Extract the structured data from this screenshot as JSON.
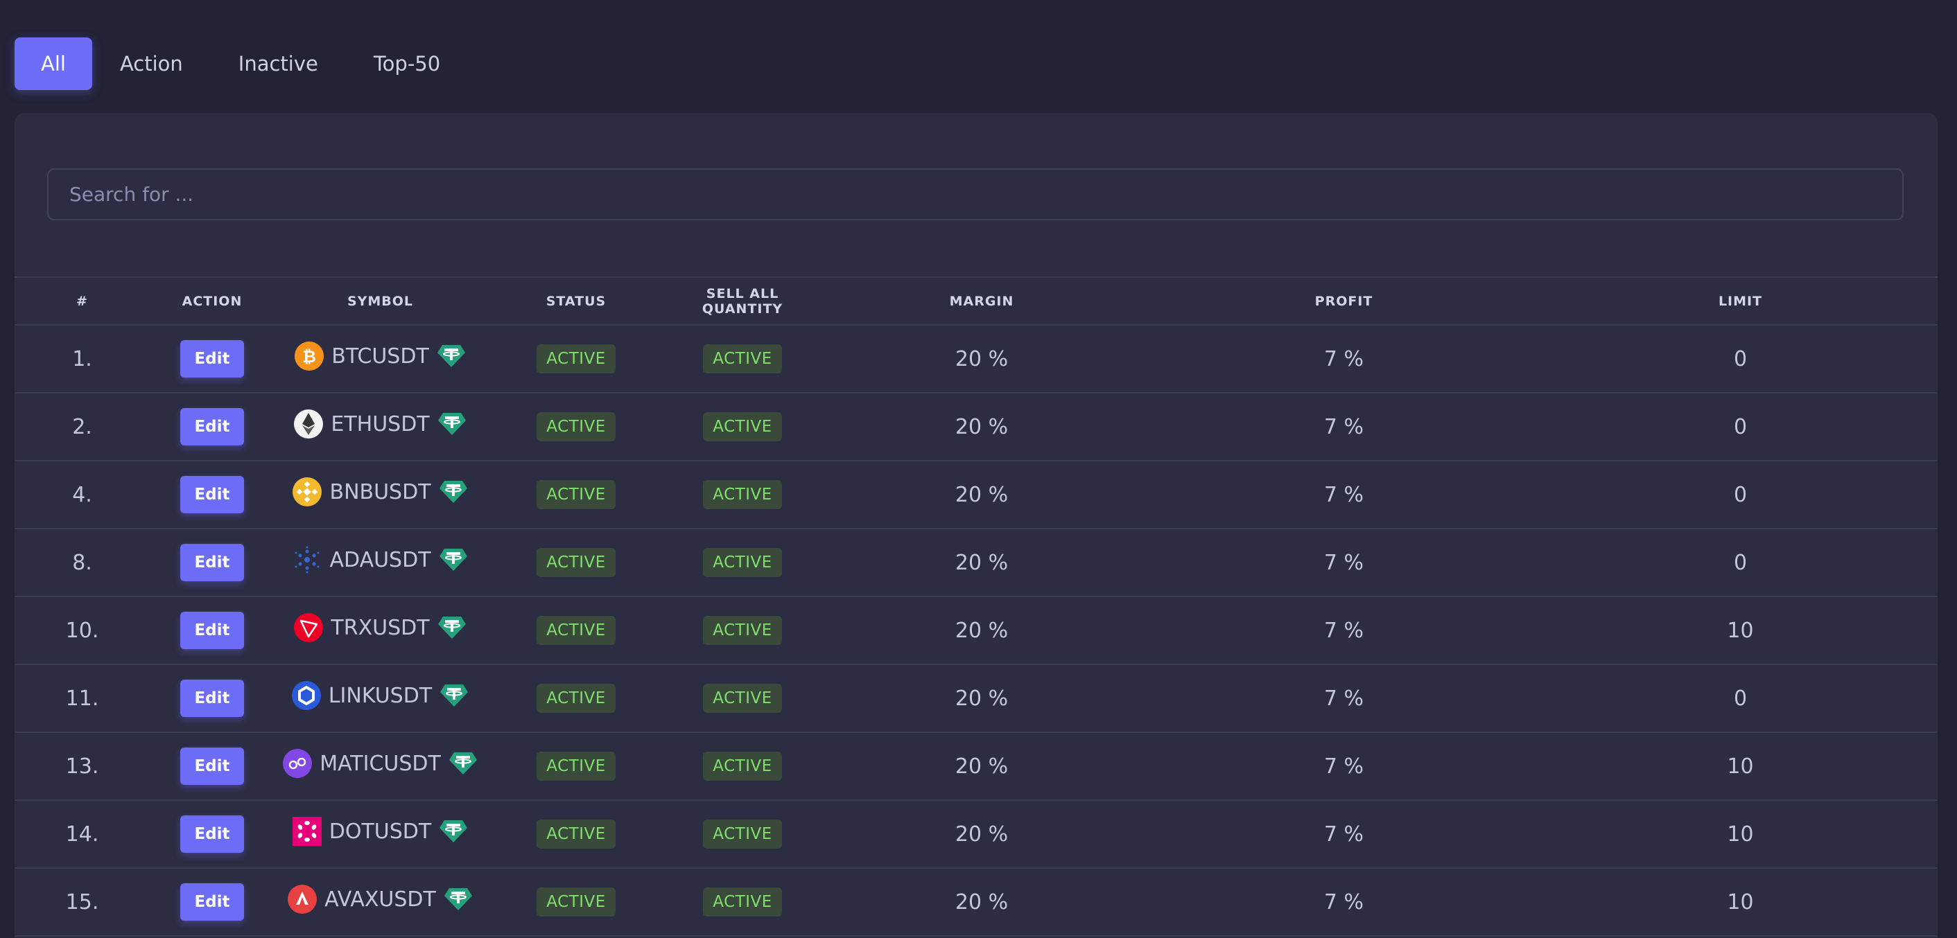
{
  "tabs": [
    {
      "label": "All",
      "active": true
    },
    {
      "label": "Action",
      "active": false
    },
    {
      "label": "Inactive",
      "active": false
    },
    {
      "label": "Top-50",
      "active": false
    }
  ],
  "search": {
    "placeholder": "Search for ...",
    "value": ""
  },
  "table": {
    "headers": [
      "#",
      "ACTION",
      "SYMBOL",
      "STATUS",
      "SELL ALL QUANTITY",
      "MARGIN",
      "PROFIT",
      "LIMIT"
    ],
    "rows": [
      {
        "num": "1.",
        "action": "Edit",
        "symbol": "BTCUSDT",
        "coin_icon": "bitcoin-icon",
        "status": "ACTIVE",
        "sell_all": "ACTIVE",
        "margin": "20 %",
        "profit": "7 %",
        "limit": "0"
      },
      {
        "num": "2.",
        "action": "Edit",
        "symbol": "ETHUSDT",
        "coin_icon": "ethereum-icon",
        "status": "ACTIVE",
        "sell_all": "ACTIVE",
        "margin": "20 %",
        "profit": "7 %",
        "limit": "0"
      },
      {
        "num": "4.",
        "action": "Edit",
        "symbol": "BNBUSDT",
        "coin_icon": "bnb-icon",
        "status": "ACTIVE",
        "sell_all": "ACTIVE",
        "margin": "20 %",
        "profit": "7 %",
        "limit": "0"
      },
      {
        "num": "8.",
        "action": "Edit",
        "symbol": "ADAUSDT",
        "coin_icon": "cardano-icon",
        "status": "ACTIVE",
        "sell_all": "ACTIVE",
        "margin": "20 %",
        "profit": "7 %",
        "limit": "0"
      },
      {
        "num": "10.",
        "action": "Edit",
        "symbol": "TRXUSDT",
        "coin_icon": "tron-icon",
        "status": "ACTIVE",
        "sell_all": "ACTIVE",
        "margin": "20 %",
        "profit": "7 %",
        "limit": "10"
      },
      {
        "num": "11.",
        "action": "Edit",
        "symbol": "LINKUSDT",
        "coin_icon": "chainlink-icon",
        "status": "ACTIVE",
        "sell_all": "ACTIVE",
        "margin": "20 %",
        "profit": "7 %",
        "limit": "0"
      },
      {
        "num": "13.",
        "action": "Edit",
        "symbol": "MATICUSDT",
        "coin_icon": "polygon-icon",
        "status": "ACTIVE",
        "sell_all": "ACTIVE",
        "margin": "20 %",
        "profit": "7 %",
        "limit": "10"
      },
      {
        "num": "14.",
        "action": "Edit",
        "symbol": "DOTUSDT",
        "coin_icon": "polkadot-icon",
        "status": "ACTIVE",
        "sell_all": "ACTIVE",
        "margin": "20 %",
        "profit": "7 %",
        "limit": "10"
      },
      {
        "num": "15.",
        "action": "Edit",
        "symbol": "AVAXUSDT",
        "coin_icon": "avalanche-icon",
        "status": "ACTIVE",
        "sell_all": "ACTIVE",
        "margin": "20 %",
        "profit": "7 %",
        "limit": "10"
      }
    ]
  },
  "colors": {
    "background": "#232336",
    "card": "#2c2d43",
    "accent": "#6c6cf7",
    "badge_bg": "#3a4a3a",
    "badge_text": "#7ee06a",
    "usdt": "#26a17b"
  }
}
